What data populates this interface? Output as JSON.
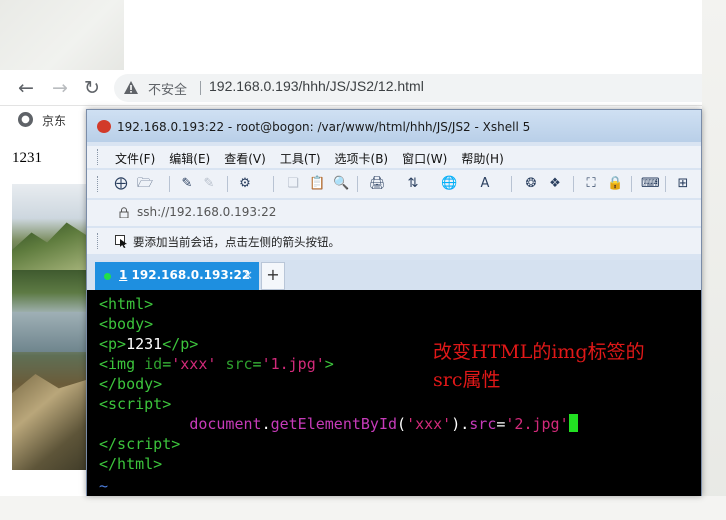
{
  "browser": {
    "url_security_label": "不安全",
    "url": "192.168.0.193/hhh/JS/JS2/12.html",
    "bookmark_label": "京东",
    "page_text": "1231"
  },
  "xshell": {
    "title": "192.168.0.193:22 - root@bogon: /var/www/html/hhh/JS/JS2 - Xshell 5",
    "menu": [
      "文件(F)",
      "编辑(E)",
      "查看(V)",
      "工具(T)",
      "选项卡(B)",
      "窗口(W)",
      "帮助(H)"
    ],
    "address": "ssh://192.168.0.193:22",
    "hint": "要添加当前会话，点击左侧的箭头按钮。",
    "tab": {
      "index": "1",
      "label": "192.168.0.193:22",
      "close": "×",
      "add": "+"
    },
    "terminal": {
      "annotation_line1": "改变HTML的img标签的",
      "annotation_line2": "src属性",
      "tilde": "~"
    }
  },
  "colors": {
    "tab_active": "#1e8fe0",
    "terminal_bg": "#000000",
    "annotation": "#e01818",
    "html_tag": "#3cc43c",
    "string": "#d22a7a",
    "method": "#c63bb9"
  }
}
